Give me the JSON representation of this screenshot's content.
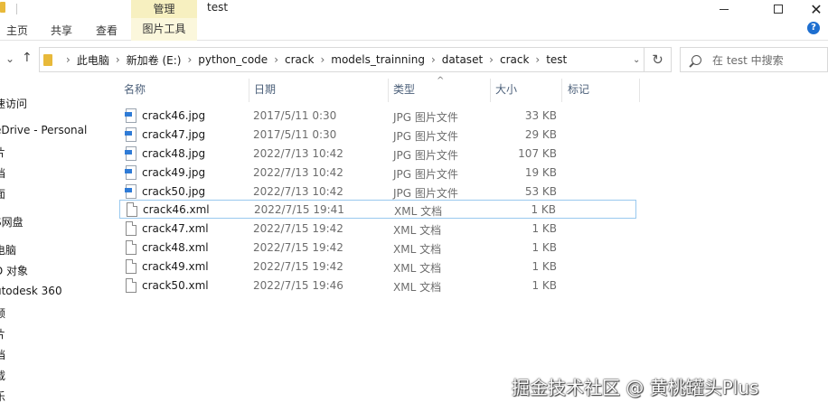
{
  "window": {
    "title": "test",
    "context_tab_header": "管理",
    "close_glyph": "✕"
  },
  "ribbon": {
    "tabs": [
      "主页",
      "共享",
      "查看"
    ],
    "context_tab": "图片工具",
    "help_glyph": "?"
  },
  "address": {
    "segments": [
      "此电脑",
      "新加卷 (E:)",
      "python_code",
      "crack",
      "models_trainning",
      "dataset",
      "crack",
      "test"
    ],
    "refresh_glyph": "↻"
  },
  "search": {
    "placeholder": "在 test 中搜索"
  },
  "nav_pane": {
    "items": [
      "速访问",
      "eDrive - Personal",
      "片",
      "档",
      "面",
      "S网盘",
      "电脑",
      "D 对象",
      "utodesk 360",
      "频",
      "片",
      "档",
      "载",
      "乐"
    ]
  },
  "columns": {
    "name": "名称",
    "date": "日期",
    "type": "类型",
    "size": "大小",
    "tags": "标记"
  },
  "files": [
    {
      "name": "crack46.jpg",
      "date": "2017/5/11 0:30",
      "type": "JPG 图片文件",
      "size": "33 KB",
      "icon": "jpg-file-icon"
    },
    {
      "name": "crack47.jpg",
      "date": "2017/5/11 0:30",
      "type": "JPG 图片文件",
      "size": "29 KB",
      "icon": "jpg-file-icon"
    },
    {
      "name": "crack48.jpg",
      "date": "2022/7/13 10:42",
      "type": "JPG 图片文件",
      "size": "107 KB",
      "icon": "jpg-file-icon"
    },
    {
      "name": "crack49.jpg",
      "date": "2022/7/13 10:42",
      "type": "JPG 图片文件",
      "size": "19 KB",
      "icon": "jpg-file-icon"
    },
    {
      "name": "crack50.jpg",
      "date": "2022/7/13 10:42",
      "type": "JPG 图片文件",
      "size": "53 KB",
      "icon": "jpg-file-icon"
    },
    {
      "name": "crack46.xml",
      "date": "2022/7/15 19:41",
      "type": "XML 文档",
      "size": "1 KB",
      "icon": "xml-file-icon",
      "selected": true
    },
    {
      "name": "crack47.xml",
      "date": "2022/7/15 19:42",
      "type": "XML 文档",
      "size": "1 KB",
      "icon": "xml-file-icon"
    },
    {
      "name": "crack48.xml",
      "date": "2022/7/15 19:42",
      "type": "XML 文档",
      "size": "1 KB",
      "icon": "xml-file-icon"
    },
    {
      "name": "crack49.xml",
      "date": "2022/7/15 19:42",
      "type": "XML 文档",
      "size": "1 KB",
      "icon": "xml-file-icon"
    },
    {
      "name": "crack50.xml",
      "date": "2022/7/15 19:46",
      "type": "XML 文档",
      "size": "1 KB",
      "icon": "xml-file-icon"
    }
  ],
  "watermark": "掘金技术社区 @ 黄桃罐头Plus"
}
